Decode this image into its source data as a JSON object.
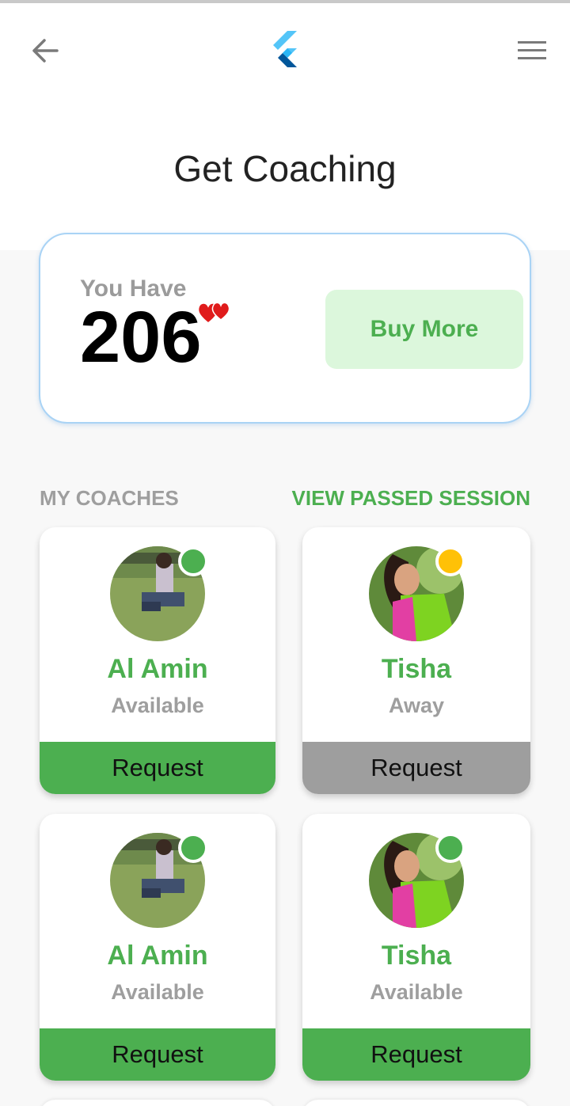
{
  "header": {
    "title": "Get Coaching",
    "back_icon": "arrow-left-icon",
    "logo_icon": "flutter-logo",
    "menu_icon": "hamburger-menu-icon"
  },
  "credits": {
    "label": "You Have",
    "count": "206",
    "icon": "hearts-icon",
    "buy_label": "Buy More"
  },
  "section": {
    "my_coaches": "MY COACHES",
    "view_passed": "VIEW PASSED SESSION"
  },
  "coaches": [
    {
      "name": "Al Amin",
      "status": "Available",
      "button": "Request",
      "status_color": "#4caf50",
      "button_color": "#4caf50"
    },
    {
      "name": "Tisha",
      "status": "Away",
      "button": "Request",
      "status_color": "#ffc107",
      "button_color": "#9e9e9e"
    },
    {
      "name": "Al Amin",
      "status": "Available",
      "button": "Request",
      "status_color": "#4caf50",
      "button_color": "#4caf50"
    },
    {
      "name": "Tisha",
      "status": "Available",
      "button": "Request",
      "status_color": "#4caf50",
      "button_color": "#4caf50"
    }
  ],
  "colors": {
    "accent": "#4caf50",
    "away": "#ffc107",
    "muted": "#9e9e9e",
    "card_border": "#a9d3f5"
  }
}
